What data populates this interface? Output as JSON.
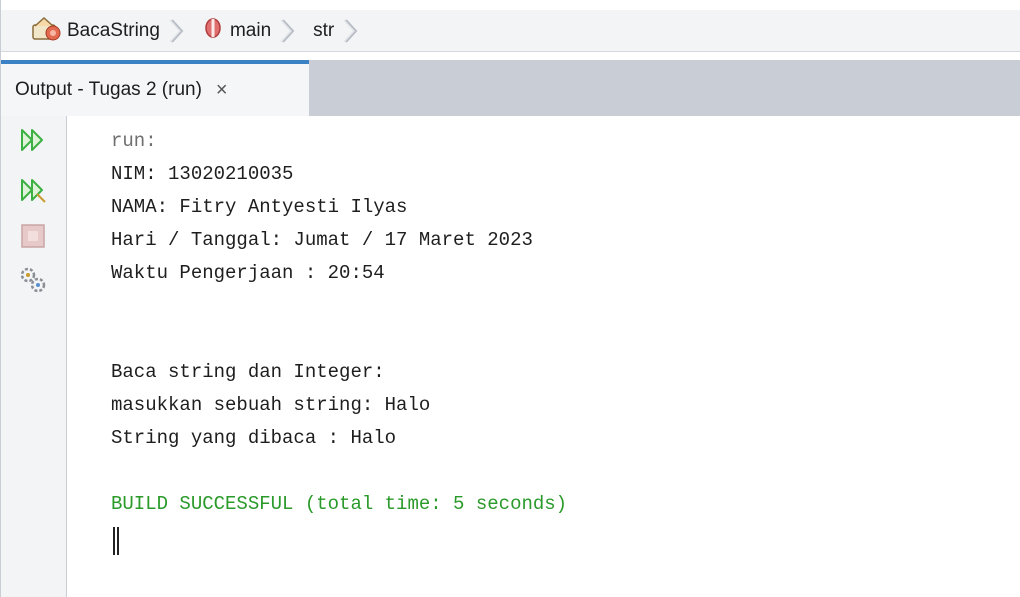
{
  "breadcrumb": {
    "items": [
      {
        "label": "BacaString",
        "icon": "class-icon"
      },
      {
        "label": "main",
        "icon": "method-icon"
      },
      {
        "label": "str",
        "icon": ""
      }
    ]
  },
  "output_tab": {
    "label": "Output - Tugas 2 (run)",
    "close": "×"
  },
  "toolbar": {
    "tools": [
      "rerun-icon",
      "rerun-with-options-icon",
      "stop-icon",
      "settings-icon"
    ]
  },
  "console": {
    "lines": [
      {
        "text": "run:",
        "style": "dim"
      },
      {
        "text": "NIM: 13020210035",
        "style": "normal"
      },
      {
        "text": "NAMA: Fitry Antyesti Ilyas",
        "style": "normal"
      },
      {
        "text": "Hari / Tanggal: Jumat / 17 Maret 2023",
        "style": "normal"
      },
      {
        "text": "Waktu Pengerjaan : 20:54",
        "style": "normal"
      },
      {
        "text": "",
        "style": "normal"
      },
      {
        "text": "",
        "style": "normal"
      },
      {
        "text": "Baca string dan Integer:",
        "style": "normal"
      },
      {
        "text": "masukkan sebuah string: Halo",
        "style": "normal"
      },
      {
        "text": "String yang dibaca : Halo",
        "style": "normal"
      },
      {
        "text": "",
        "style": "normal"
      },
      {
        "text": "BUILD SUCCESSFUL (total time: 5 seconds)",
        "style": "ok"
      }
    ]
  },
  "colors": {
    "success": "#2a9a2a",
    "tab_accent": "#3b82c4",
    "run_green": "#3cb043",
    "stop_red": "#d65c5c"
  }
}
